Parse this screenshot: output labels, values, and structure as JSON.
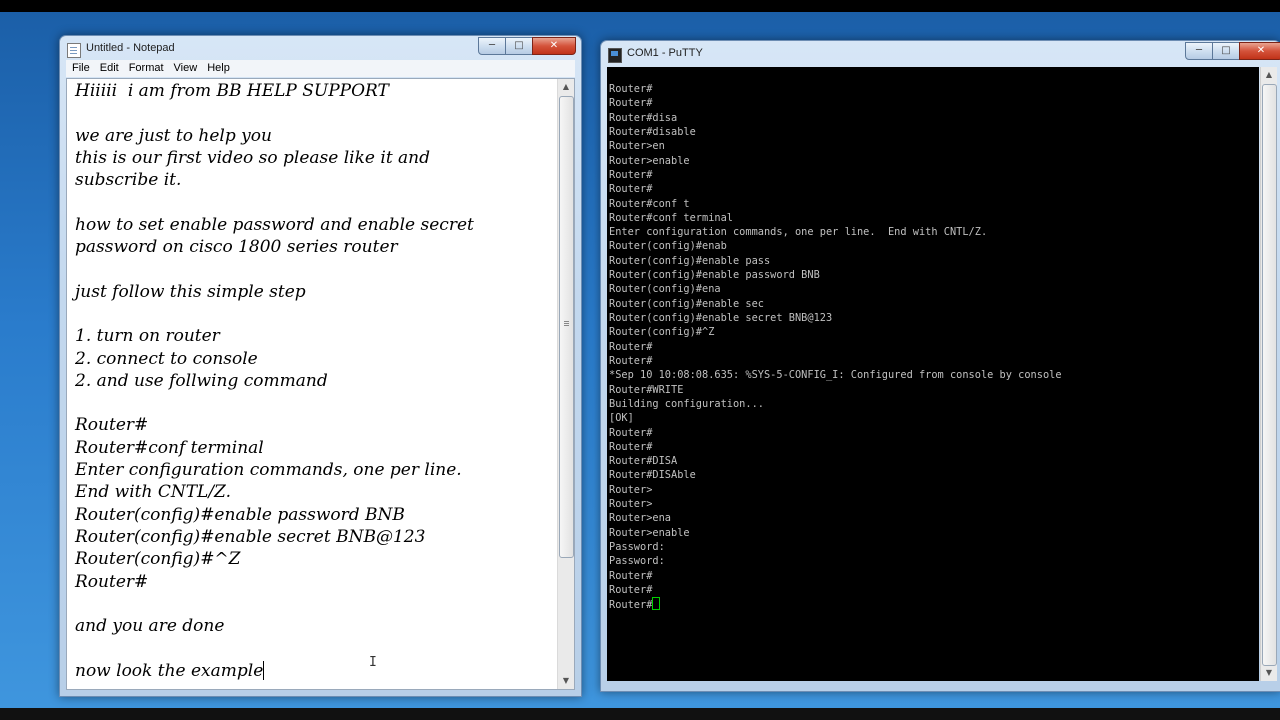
{
  "notepad": {
    "title": "Untitled - Notepad",
    "menu": [
      "File",
      "Edit",
      "Format",
      "View",
      "Help"
    ],
    "lines": [
      "Hiiiii  i am from BB HELP SUPPORT",
      "",
      "we are just to help you",
      "this is our first video so please like it and",
      "subscribe it.",
      "",
      "how to set enable password and enable secret",
      "password on cisco 1800 series router",
      "",
      "just follow this simple step",
      "",
      "1. turn on router",
      "2. connect to console",
      "2. and use follwing command",
      "",
      "Router#",
      "Router#conf terminal",
      "Enter configuration commands, one per line.",
      "End with CNTL/Z.",
      "Router(config)#enable password BNB",
      "Router(config)#enable secret BNB@123",
      "Router(config)#^Z",
      "Router#",
      "",
      "and you are done",
      "",
      "now look the example"
    ]
  },
  "putty": {
    "title": "COM1 - PuTTY",
    "lines": [
      "Router#",
      "Router#",
      "Router#disa",
      "Router#disable",
      "Router>en",
      "Router>enable",
      "Router#",
      "Router#",
      "Router#conf t",
      "Router#conf terminal",
      "Enter configuration commands, one per line.  End with CNTL/Z.",
      "Router(config)#enab",
      "Router(config)#enable pass",
      "Router(config)#enable password BNB",
      "Router(config)#ena",
      "Router(config)#enable sec",
      "Router(config)#enable secret BNB@123",
      "Router(config)#^Z",
      "Router#",
      "Router#",
      "*Sep 10 10:08:08.635: %SYS-5-CONFIG_I: Configured from console by console",
      "Router#WRITE",
      "Building configuration...",
      "[OK]",
      "Router#",
      "Router#",
      "Router#DISA",
      "Router#DISAble",
      "Router>",
      "Router>",
      "Router>ena",
      "Router>enable",
      "Password:",
      "Password:",
      "Router#",
      "Router#",
      "Router#"
    ]
  },
  "window_buttons": {
    "minimize_icon": "minimize-icon",
    "maximize_icon": "maximize-icon",
    "close_icon": "close-icon"
  },
  "colors": {
    "terminal_bg": "#000000",
    "terminal_fg": "#c0c0c0",
    "cursor": "#00d000",
    "close_button": "#c13319"
  }
}
